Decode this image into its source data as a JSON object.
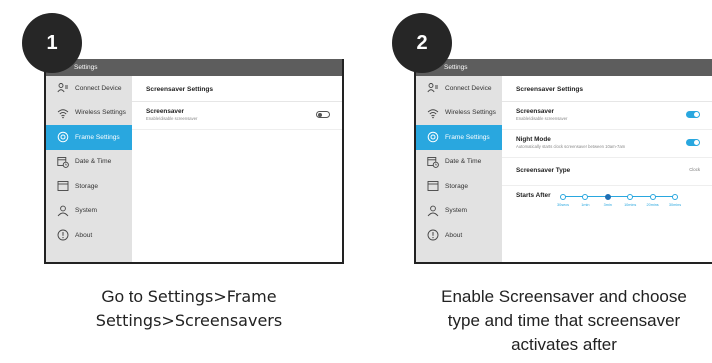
{
  "steps": [
    {
      "number": "1",
      "caption_line1_prefix": "Go to ",
      "caption_line1_bold": "Settings>Frame",
      "caption_line2_bold": "Settings>Screensavers",
      "window_title": "Settings",
      "content_title": "Screensaver Settings",
      "rows": [
        {
          "title": "Screensaver",
          "subtitle": "Enable/disable screensaver",
          "toggle": "off"
        }
      ]
    },
    {
      "number": "2",
      "caption_line1": "Enable Screensaver and choose",
      "caption_line2": "type and time that screensaver",
      "caption_line3": "activates after",
      "window_title": "Settings",
      "content_title": "Screensaver Settings",
      "rows": [
        {
          "title": "Screensaver",
          "subtitle": "Enable/disable screensaver",
          "toggle": "on"
        },
        {
          "title": "Night Mode",
          "subtitle": "Automatically starts clock screensaver between 10am-7am",
          "toggle": "on"
        },
        {
          "title": "Screensaver Type",
          "value": "Clock"
        },
        {
          "title": "Starts After"
        }
      ],
      "starts_after": {
        "options": [
          "30secs",
          "1min",
          "3min",
          "10mins",
          "20mins",
          "30mins"
        ],
        "selected": "3min"
      }
    }
  ],
  "sidebar": {
    "items": [
      {
        "label": "Connect Device",
        "icon": "connect-device-icon"
      },
      {
        "label": "Wireless Settings",
        "icon": "wifi-icon"
      },
      {
        "label": "Frame Settings",
        "icon": "frame-settings-icon",
        "active": true
      },
      {
        "label": "Date & Time",
        "icon": "calendar-clock-icon"
      },
      {
        "label": "Storage",
        "icon": "storage-icon"
      },
      {
        "label": "System",
        "icon": "user-icon"
      },
      {
        "label": "About",
        "icon": "info-icon"
      }
    ]
  },
  "colors": {
    "accent": "#29a7df",
    "sidebar_bg": "#e2e2e2",
    "titlebar_bg": "#5d5d5d",
    "badge_bg": "#262626"
  }
}
